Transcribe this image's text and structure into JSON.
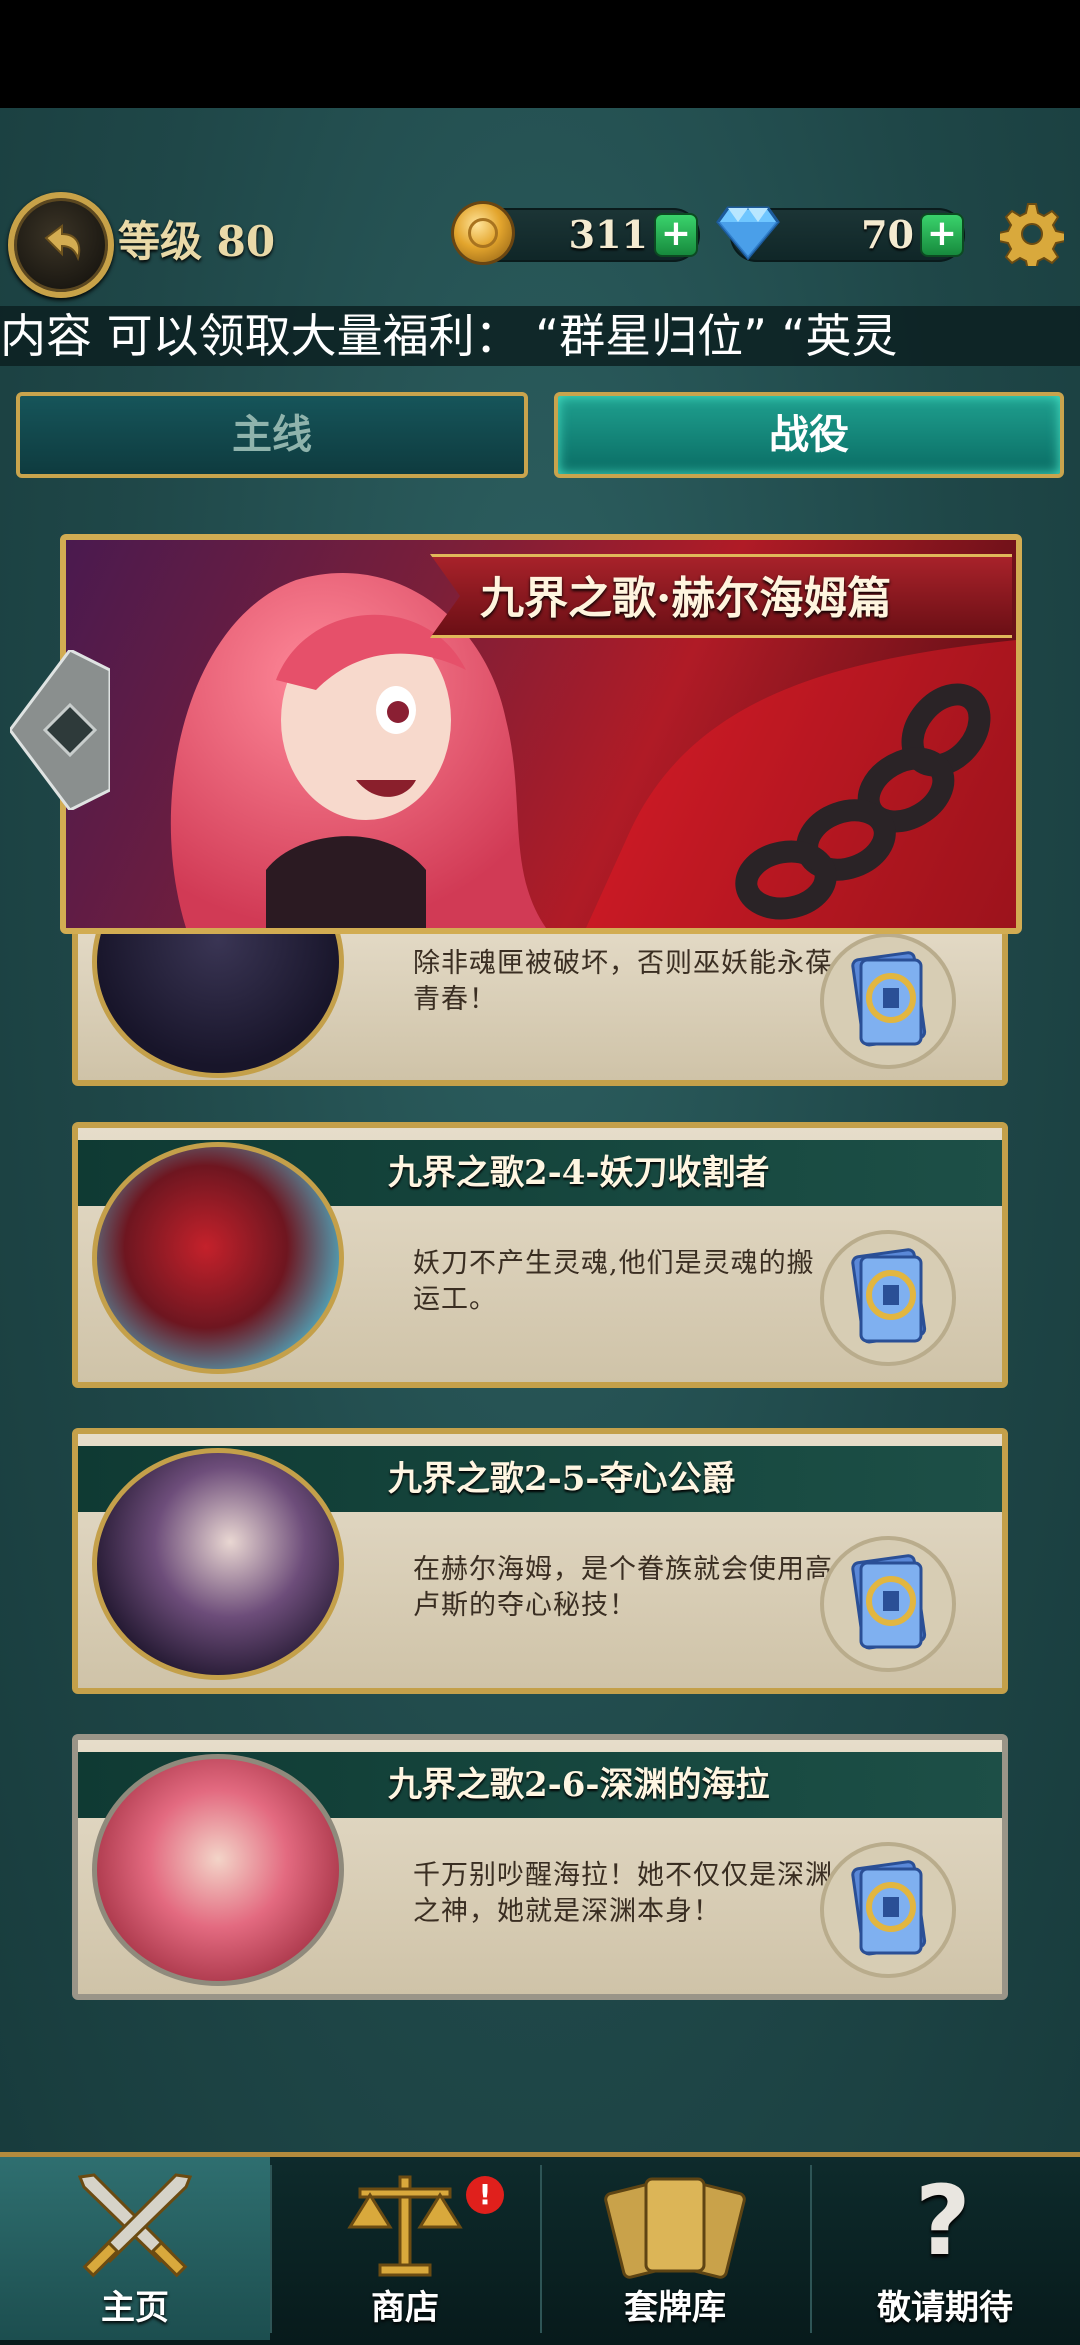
{
  "header": {
    "level_label": "等级 80",
    "coins": "311",
    "gems": "70"
  },
  "marquee": {
    "text": "内容 可以领取大量福利：  “群星归位”  “英灵"
  },
  "tabs": [
    {
      "label": "主线",
      "active": false
    },
    {
      "label": "战役",
      "active": true
    }
  ],
  "banner": {
    "title": "九界之歌·赫尔海姆篇"
  },
  "stages": [
    {
      "title": "",
      "desc": "除非魂匣被破坏，否则巫妖能永葆青春！"
    },
    {
      "title": "九界之歌2-4-妖刀收割者",
      "desc": "妖刀不产生灵魂,他们是灵魂的搬运工。"
    },
    {
      "title": "九界之歌2-5-夺心公爵",
      "desc": "在赫尔海姆，是个眷族就会使用高卢斯的夺心秘技！"
    },
    {
      "title": "九界之歌2-6-深渊的海拉",
      "desc": "千万别吵醒海拉！她不仅仅是深渊之神，她就是深渊本身！"
    }
  ],
  "nav": [
    {
      "label": "主页",
      "active": true
    },
    {
      "label": "商店",
      "badge": "!"
    },
    {
      "label": "套牌库"
    },
    {
      "label": "敬请期待"
    }
  ],
  "colors": {
    "accent_gold": "#c8a248",
    "tab_active": "#1fa08f",
    "background": "#1e4547"
  },
  "icons": [
    "back-arrow-icon",
    "coin-icon",
    "gem-icon",
    "plus-icon",
    "gear-icon",
    "swords-icon",
    "scales-icon",
    "cards-icon",
    "question-icon",
    "card-pack-icon"
  ]
}
